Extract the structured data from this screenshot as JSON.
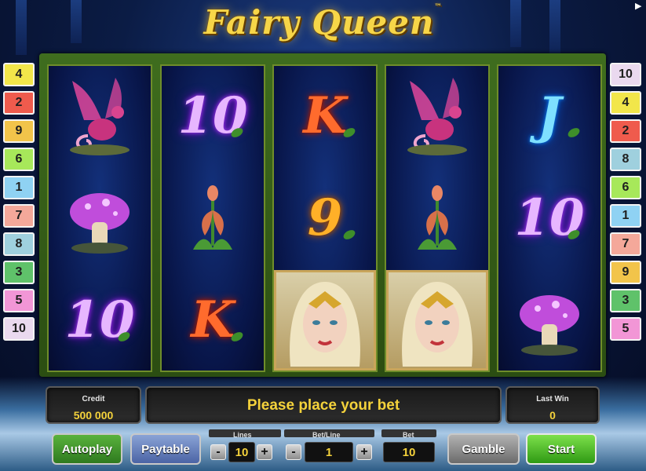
{
  "game": {
    "title": "Fairy Queen",
    "trademark": "™"
  },
  "reels": [
    [
      {
        "symbol": "dragon",
        "color": "#e0479b"
      },
      {
        "symbol": "mushroom",
        "color": "#c04ddb"
      },
      {
        "symbol": "10",
        "style": "purple"
      }
    ],
    [
      {
        "symbol": "10",
        "style": "purple"
      },
      {
        "symbol": "flower",
        "color": "#d8704a"
      },
      {
        "symbol": "K",
        "style": "red"
      }
    ],
    [
      {
        "symbol": "K",
        "style": "red"
      },
      {
        "symbol": "9",
        "style": "orange"
      },
      {
        "symbol": "fairy-queen",
        "color": "#e9d6a0"
      }
    ],
    [
      {
        "symbol": "dragon",
        "color": "#e0479b"
      },
      {
        "symbol": "flower",
        "color": "#d8704a"
      },
      {
        "symbol": "fairy-queen",
        "color": "#e9d6a0"
      }
    ],
    [
      {
        "symbol": "J",
        "style": "blue"
      },
      {
        "symbol": "10",
        "style": "purple"
      },
      {
        "symbol": "mushroom",
        "color": "#c04ddb"
      }
    ]
  ],
  "left_lines": [
    {
      "n": "4",
      "color": "#f2e64a"
    },
    {
      "n": "2",
      "color": "#ef5b4d"
    },
    {
      "n": "9",
      "color": "#f2c44a"
    },
    {
      "n": "6",
      "color": "#a7e85a"
    },
    {
      "n": "1",
      "color": "#8fd2f3"
    },
    {
      "n": "7",
      "color": "#f4a89a"
    },
    {
      "n": "8",
      "color": "#9fd0de"
    },
    {
      "n": "3",
      "color": "#5fc26a"
    },
    {
      "n": "5",
      "color": "#f296d6"
    },
    {
      "n": "10",
      "color": "#ead9ef"
    }
  ],
  "right_lines": [
    {
      "n": "10",
      "color": "#ead9ef"
    },
    {
      "n": "4",
      "color": "#f2e64a"
    },
    {
      "n": "2",
      "color": "#ef5b4d"
    },
    {
      "n": "8",
      "color": "#9fd0de"
    },
    {
      "n": "6",
      "color": "#a7e85a"
    },
    {
      "n": "1",
      "color": "#8fd2f3"
    },
    {
      "n": "7",
      "color": "#f4a89a"
    },
    {
      "n": "9",
      "color": "#f2c44a"
    },
    {
      "n": "3",
      "color": "#5fc26a"
    },
    {
      "n": "5",
      "color": "#f296d6"
    }
  ],
  "panel": {
    "credit_label": "Credit",
    "credit_value": "500 000",
    "message": "Please place your bet",
    "last_win_label": "Last Win",
    "last_win_value": "0"
  },
  "controls": {
    "autoplay": "Autoplay",
    "paytable": "Paytable",
    "lines_label": "Lines",
    "lines_value": "10",
    "bet_line_label": "Bet/Line",
    "bet_line_value": "1",
    "bet_label": "Bet",
    "bet_value": "10",
    "minus": "-",
    "plus": "+",
    "gamble": "Gamble",
    "start": "Start"
  }
}
